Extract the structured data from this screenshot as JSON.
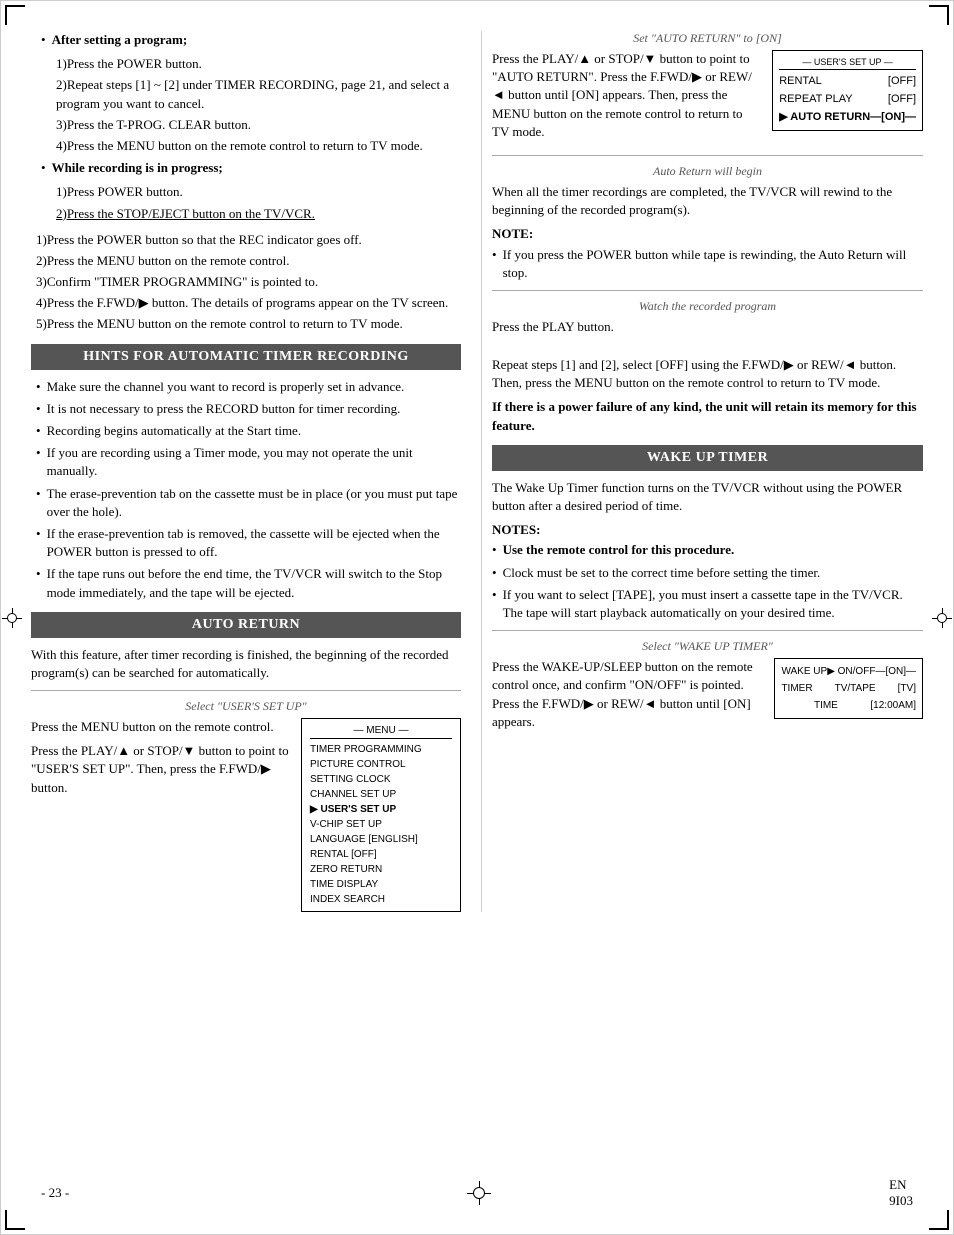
{
  "page": {
    "number": "- 23 -",
    "code": "EN\n9I03"
  },
  "left_col": {
    "after_setting": {
      "heading": "After setting a program;",
      "steps": [
        "1)Press the POWER button.",
        "2)Repeat steps [1] ~ [2] under TIMER RECORDING, page 21, and select a program you want to cancel.",
        "3)Press the T-PROG. CLEAR button.",
        "4)Press the MENU button on the remote control to return to TV mode."
      ]
    },
    "while_recording": {
      "heading": "While recording is in progress;",
      "steps": [
        "1)Press POWER button.",
        "2)Press the STOP/EJECT button on the TV/VCR."
      ]
    },
    "steps_below": [
      "1)Press the POWER button so that the REC indicator goes off.",
      "2)Press the MENU button on the remote control.",
      "3)Confirm \"TIMER PROGRAMMING\" is pointed to.",
      "4)Press the F.FWD/▶ button. The details of programs appear on the TV screen.",
      "5)Press the MENU button on the remote control to return to TV mode."
    ],
    "hints_header": "HINTS FOR AUTOMATIC TIMER RECORDING",
    "hints": [
      "Make sure the channel you want to record is properly set in advance.",
      "It is not necessary to press the RECORD button for timer recording.",
      "Recording begins automatically at the Start time.",
      "If you are recording using a Timer mode, you may not operate the unit manually.",
      "The erase-prevention tab on the cassette must be in place (or you must put tape over the hole).",
      "If the erase-prevention tab is removed, the cassette will be ejected when the POWER button is pressed to off.",
      "If the tape runs out before the end time, the TV/VCR will switch to the Stop mode immediately, and the tape will be ejected."
    ],
    "auto_return_header": "AUTO RETURN",
    "auto_return_desc": "With this feature, after timer recording is finished, the beginning of the recorded program(s) can be searched for automatically.",
    "select_users_sub": "Select \"USER'S SET UP\"",
    "select_users_steps": [
      "Press the MENU button on the remote control.",
      "Press the PLAY/▲ or STOP/▼ button to point to \"USER'S SET UP\". Then, press the F.FWD/▶ button."
    ],
    "menu_box": {
      "title": "— MENU —",
      "items": [
        "TIMER PROGRAMMING",
        "PICTURE CONTROL",
        "SETTING CLOCK",
        "CHANNEL SET UP",
        "▶ USER'S SET UP",
        "V-CHIP SET UP",
        "LANGUAGE  [ENGLISH]",
        "RENTAL  [OFF]",
        "ZERO RETURN",
        "TIME DISPLAY",
        "INDEX SEARCH"
      ]
    }
  },
  "right_col": {
    "set_auto_return_sub": "Set \"AUTO RETURN\" to [ON]",
    "set_auto_return_text": "Press the PLAY/▲ or STOP/▼ button to point to \"AUTO RETURN\". Press the F.FWD/▶ or REW/◄ button until [ON] appears. Then, press the MENU button on the remote control to return to TV mode.",
    "users_set_box": {
      "title": "— USER'S SET UP —",
      "rows": [
        {
          "label": "RENTAL",
          "value": "[OFF]"
        },
        {
          "label": "REPEAT PLAY",
          "value": "[OFF]"
        },
        {
          "label": "▶ AUTO RETURN",
          "value": "—[ON]—"
        }
      ]
    },
    "auto_return_begin_sub": "Auto Return will begin",
    "auto_return_begin_text": "When all the timer recordings are completed, the TV/VCR will rewind to the beginning of the recorded program(s).",
    "note_label": "NOTE:",
    "note_item": "If you press the POWER button while tape is rewinding, the Auto Return will stop.",
    "watch_program_sub": "Watch the recorded program",
    "watch_program_text": "Press the PLAY button.",
    "repeat_text": "Repeat steps [1] and [2], select [OFF] using the F.FWD/▶ or REW/◄ button. Then, press the MENU button on the remote control to return to TV mode.",
    "power_failure_text": "If there is a power failure of any kind, the unit will retain its memory for this feature.",
    "wake_up_header": "WAKE UP TIMER",
    "wake_up_desc": "The Wake Up Timer function turns on the TV/VCR without using the POWER button after a desired period of time.",
    "notes_label": "NOTES:",
    "wake_up_notes": [
      "Use the remote control for this procedure.",
      "Clock must be set to the correct time before setting the timer.",
      "If you want to select [TAPE], you must insert a cassette tape in the TV/VCR. The tape will start playback automatically on your desired time."
    ],
    "select_wakeup_sub": "Select \"WAKE UP TIMER\"",
    "select_wakeup_text": "Press the WAKE-UP/SLEEP button on the remote control once, and confirm \"ON/OFF\" is pointed. Press the F.FWD/▶ or REW/◄ button until [ON] appears.",
    "wakeup_box": {
      "rows": [
        {
          "label": "WAKE UP",
          "col2": "▶ ON/OFF",
          "col3": "—[ON]—"
        },
        {
          "label": "TIMER",
          "col2": "TV/TAPE",
          "col3": "[TV]"
        },
        {
          "label": "",
          "col2": "TIME",
          "col3": "[12:00AM]"
        }
      ]
    }
  }
}
